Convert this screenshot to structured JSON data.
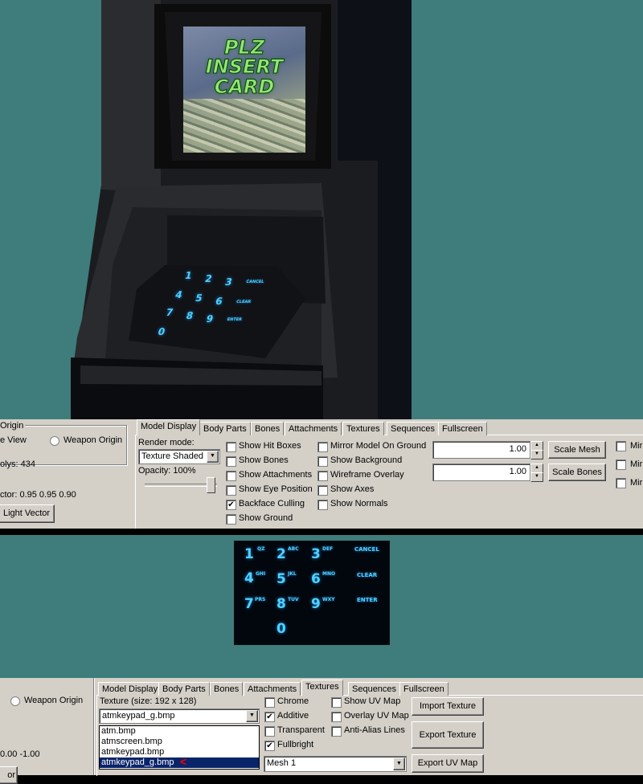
{
  "atm_screen": {
    "line1": "PLZ",
    "line2": "INSERT",
    "line3": "CARD"
  },
  "keypad": {
    "keys": [
      {
        "digit": "1",
        "sup": "QZ"
      },
      {
        "digit": "2",
        "sup": "ABC"
      },
      {
        "digit": "3",
        "sup": "DEF"
      },
      {
        "digit": "4",
        "sup": "GHI"
      },
      {
        "digit": "5",
        "sup": "JKL"
      },
      {
        "digit": "6",
        "sup": "MNO"
      },
      {
        "digit": "7",
        "sup": "PRS"
      },
      {
        "digit": "8",
        "sup": "TUV"
      },
      {
        "digit": "9",
        "sup": "WXY"
      },
      {
        "digit": "0",
        "sup": ""
      }
    ],
    "cancel": "CANCEL",
    "clear": "CLEAR",
    "enter": "ENTER"
  },
  "top_panel": {
    "tabs": [
      "Model Display",
      "Body Parts",
      "Bones",
      "Attachments",
      "Textures",
      "Sequences",
      "Fullscreen"
    ],
    "active_tab": "Model Display",
    "left": {
      "group_title": "Origin",
      "view_label": "e View",
      "weapon_origin_label": "Weapon Origin",
      "polys_label": "olys: 434",
      "vector_label": "ctor: 0.95 0.95 0.90",
      "light_vector_button": "Light Vector"
    },
    "render_mode_label": "Render mode:",
    "render_mode_value": "Texture Shaded",
    "opacity_label": "Opacity: 100%",
    "opacity_value": 1.0,
    "checkboxes_col1": [
      {
        "label": "Show Hit Boxes",
        "checked": false
      },
      {
        "label": "Show Bones",
        "checked": false
      },
      {
        "label": "Show Attachments",
        "checked": false
      },
      {
        "label": "Show Eye Position",
        "checked": false
      },
      {
        "label": "Backface Culling",
        "checked": true
      },
      {
        "label": "Show Ground",
        "checked": false
      }
    ],
    "checkboxes_col2": [
      {
        "label": "Mirror Model On Ground",
        "checked": false
      },
      {
        "label": "Show Background",
        "checked": false
      },
      {
        "label": "Wireframe Overlay",
        "checked": false
      },
      {
        "label": "Show Axes",
        "checked": false
      },
      {
        "label": "Show Normals",
        "checked": false
      }
    ],
    "scale_mesh_value": "1.00",
    "scale_mesh_button": "Scale Mesh",
    "scale_bones_value": "1.00",
    "scale_bones_button": "Scale Bones",
    "right_cut_labels": [
      "Mirr",
      "Mirr",
      "Mirr"
    ]
  },
  "bottom_panel": {
    "tabs": [
      "Model Display",
      "Body Parts",
      "Bones",
      "Attachments",
      "Textures",
      "Sequences",
      "Fullscreen"
    ],
    "active_tab": "Textures",
    "weapon_origin_label": "Weapon Origin",
    "vector_label": "0.00 -1.00",
    "cut_button": "or",
    "texture_label": "Texture (size: 192 x 128)",
    "texture_selected": "atmkeypad_g.bmp",
    "texture_list": [
      "atm.bmp",
      "atmscreen.bmp",
      "atmkeypad.bmp",
      "atmkeypad_g.bmp"
    ],
    "arrow_annotation": "<",
    "checkboxes_col1": [
      {
        "label": "Chrome",
        "checked": false
      },
      {
        "label": "Additive",
        "checked": true
      },
      {
        "label": "Transparent",
        "checked": false
      },
      {
        "label": "Fullbright",
        "checked": true
      }
    ],
    "checkboxes_col2": [
      {
        "label": "Show UV Map",
        "checked": false
      },
      {
        "label": "Overlay UV Map",
        "checked": false
      },
      {
        "label": "Anti-Alias Lines",
        "checked": false
      }
    ],
    "mesh_value": "Mesh 1",
    "import_button": "Import Texture",
    "export_button": "Export Texture",
    "export_uv_button": "Export UV Map"
  },
  "colors": {
    "viewport_bg": "#3e7d7b",
    "panel_bg": "#d4d0c8",
    "glow": "#4fd2ff",
    "selection": "#0a246a",
    "annotation": "#ff0000"
  }
}
